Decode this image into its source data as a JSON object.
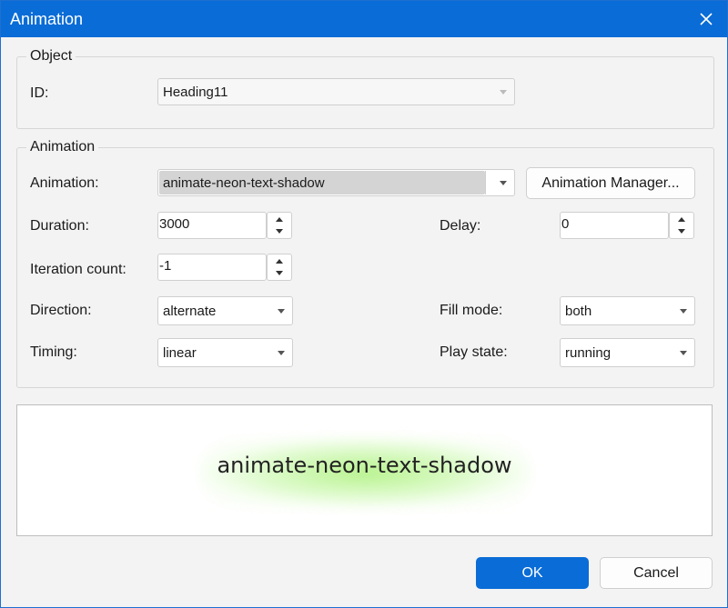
{
  "window": {
    "title": "Animation"
  },
  "object": {
    "legend": "Object",
    "id_label": "ID:",
    "id_value": "Heading11"
  },
  "animation": {
    "legend": "Animation",
    "animation_label": "Animation:",
    "animation_value": "animate-neon-text-shadow",
    "manager_button": "Animation Manager...",
    "duration_label": "Duration:",
    "duration_value": "3000",
    "delay_label": "Delay:",
    "delay_value": "0",
    "iteration_label": "Iteration count:",
    "iteration_value": "-1",
    "direction_label": "Direction:",
    "direction_value": "alternate",
    "fill_label": "Fill mode:",
    "fill_value": "both",
    "timing_label": "Timing:",
    "timing_value": "linear",
    "play_label": "Play state:",
    "play_value": "running"
  },
  "preview": {
    "text": "animate-neon-text-shadow",
    "glow_color": "#a6f07a"
  },
  "buttons": {
    "ok": "OK",
    "cancel": "Cancel"
  },
  "colors": {
    "accent": "#0a6cd6"
  }
}
